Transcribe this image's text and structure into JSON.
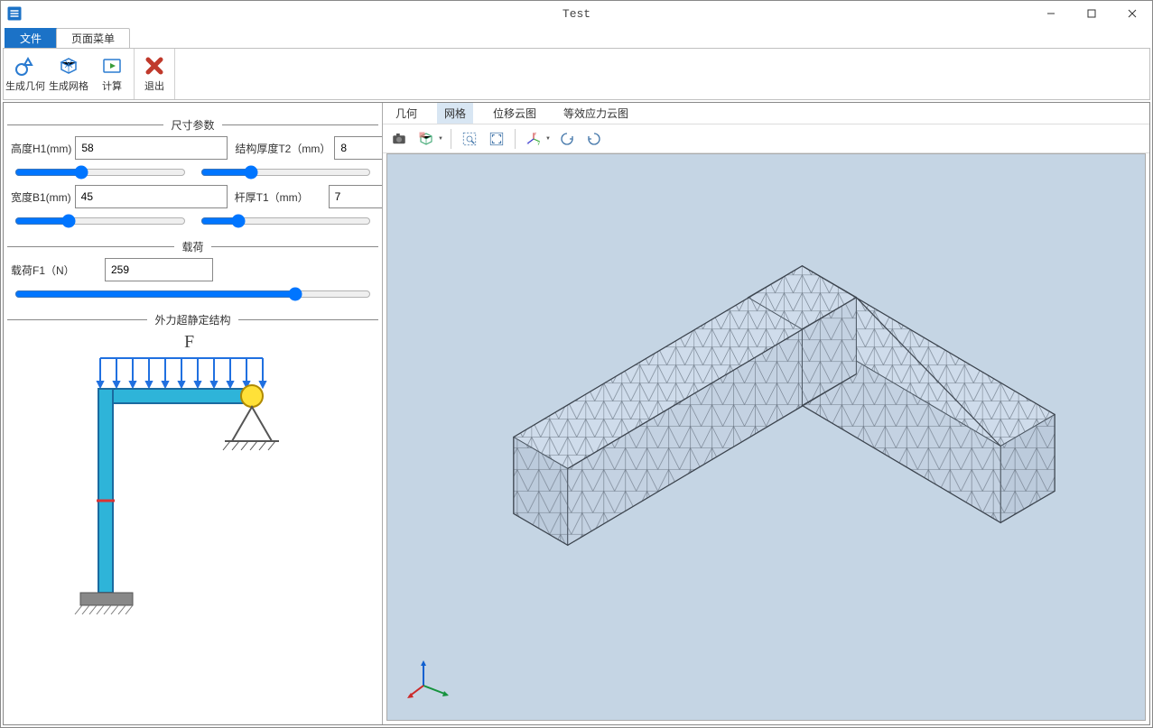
{
  "window": {
    "title": "Test"
  },
  "tabs": {
    "file": "文件",
    "page_menu": "页面菜单"
  },
  "ribbon": {
    "gen_geometry": "生成几何",
    "gen_mesh": "生成网格",
    "compute": "计算",
    "exit": "退出"
  },
  "params": {
    "section_dim": "尺寸参数",
    "section_load": "载荷",
    "section_struct": "外力超静定结构",
    "h1_label": "高度H1(mm)",
    "h1_value": "58",
    "t2_label": "结构厚度T2（mm）",
    "t2_value": "8",
    "b1_label": "宽度B1(mm)",
    "b1_value": "45",
    "t1_label": "杆厚T1（mm）",
    "t1_value": "7",
    "f1_label": "载荷F1（N）",
    "f1_value": "259",
    "diagram_F": "F"
  },
  "viewer_tabs": {
    "geometry": "几何",
    "mesh": "网格",
    "disp_contour": "位移云图",
    "stress_contour": "等效应力云图"
  }
}
